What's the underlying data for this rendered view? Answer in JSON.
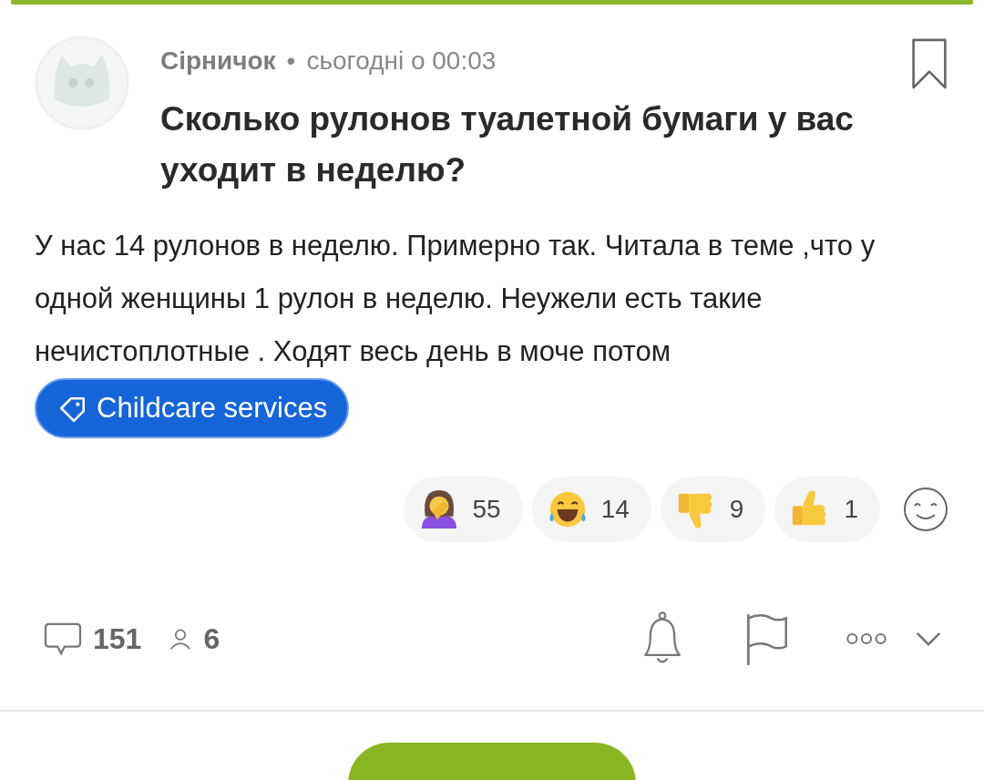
{
  "post": {
    "author": "Сірничок",
    "separator": "•",
    "time": "сьогодні о 00:03",
    "bookmarked": false,
    "title": "Сколько рулонов туалетной бумаги у вас уходит в неделю?",
    "body": "У нас 14 рулонов в неделю. Примерно так. Читала в теме ,что у одной женщины 1 рулон в неделю. Неужели есть такие нечистоплотные . Ходят весь день в моче потом",
    "chip": "Childcare services"
  },
  "reactions": [
    {
      "kind": "facepalm",
      "count": "55"
    },
    {
      "kind": "laugh",
      "count": "14"
    },
    {
      "kind": "thumbsdown",
      "count": "9"
    },
    {
      "kind": "thumbsup",
      "count": "1"
    }
  ],
  "footer": {
    "comments": "151",
    "participants": "6"
  }
}
